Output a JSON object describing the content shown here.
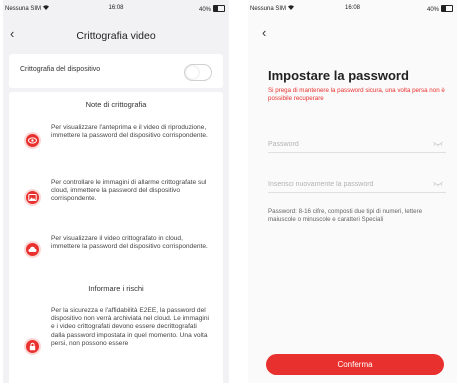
{
  "left": {
    "status": {
      "carrier": "Nessuna SIM",
      "time": "16:08",
      "battery": "40%"
    },
    "title": "Crittografia video",
    "toggle": {
      "label": "Crittografia del dispositivo",
      "on": false
    },
    "notes": {
      "title": "Note di crittografia",
      "items": [
        {
          "icon": "eye-icon",
          "text": "Per visualizzare l'anteprima e il video di riproduzione, immettere la password del dispositivo corrispondente."
        },
        {
          "icon": "alarm-image-icon",
          "text": "Per controllare le immagini di allarme crittografate sul cloud, immettere la password del dispositivo corrispondente."
        },
        {
          "icon": "cloud-video-icon",
          "text": "Per visualizzare il video crittografato in cloud, immettere la password del dispositivo corrispondente."
        }
      ]
    },
    "risks": {
      "title": "Informare i rischi",
      "icon": "lock-icon",
      "text": "Per la sicurezza e l'affidabilità E2EE, la password del dispositivo non verrà archiviata nel cloud. Le immagini e i video crittografati devono essere decrittografati dalla password impostata in quel momento. Una volta persi, non possono essere"
    }
  },
  "right": {
    "status": {
      "carrier": "Nessuna SIM",
      "time": "16:08",
      "battery": "40%"
    },
    "title": "Impostare la password",
    "subtitle": "Si prega di mantenere la password sicura, una volta persa non è possibile recuperare",
    "password_placeholder": "Password",
    "confirm_placeholder": "Inserisci nuovamente la password",
    "hint": "Password: 8-16 cifre, composti due tipi di numeri, lettere maiuscole o minuscole e caratteri Speciali",
    "confirm_label": "Conferma"
  },
  "colors": {
    "accent": "#e8312e"
  }
}
